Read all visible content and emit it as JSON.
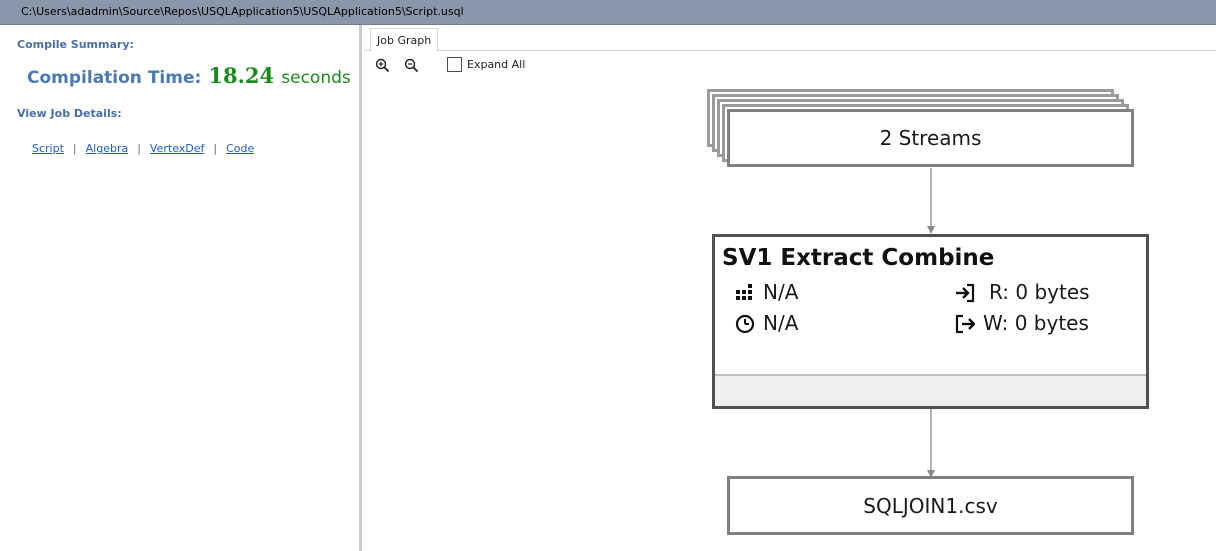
{
  "window": {
    "title": "C:\\Users\\adadmin\\Source\\Repos\\USQLApplication5\\USQLApplication5\\Script.usql"
  },
  "summary": {
    "heading": "Compile Summary:",
    "compilation_label": "Compilation Time:",
    "compilation_value": "18.24",
    "compilation_unit": "seconds",
    "details_heading": "View Job Details:",
    "links": [
      "Script",
      "Algebra",
      "VertexDef",
      "Code"
    ],
    "separator": "|"
  },
  "graph": {
    "tab_label": "Job Graph",
    "expand_all_label": "Expand All",
    "expand_all_checked": false,
    "input_node": {
      "label": "2 Streams"
    },
    "vertex": {
      "title": "SV1 Extract Combine",
      "vertices_value": "N/A",
      "time_value": "N/A",
      "read": "R: 0 bytes",
      "write": "W: 0 bytes"
    },
    "output_node": {
      "label": "SQLJOIN1.csv"
    }
  },
  "icons": {
    "zoom_in": "zoom-in-icon",
    "zoom_out": "zoom-out-icon",
    "vertices": "grid-icon",
    "time": "clock-icon",
    "read": "arrow-into-box-icon",
    "write": "arrow-out-of-box-icon"
  },
  "colors": {
    "titlebar": "#8a96aa",
    "summary_heading": "#4a6fa5",
    "compilation_label": "#4c79b4",
    "compilation_value": "#1a8b1a",
    "link": "#1f5fbf"
  }
}
